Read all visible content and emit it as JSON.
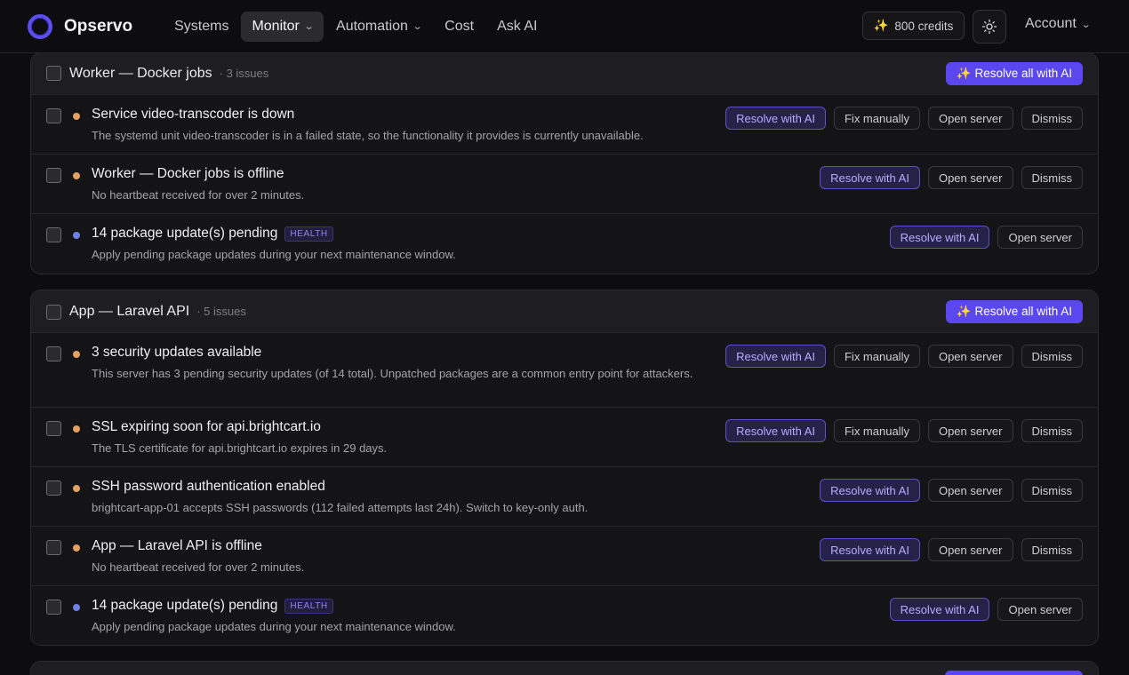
{
  "app": {
    "name": "Opservo"
  },
  "nav": {
    "items": [
      {
        "label": "Systems",
        "active": false,
        "dropdown": false
      },
      {
        "label": "Monitor",
        "active": true,
        "dropdown": true
      },
      {
        "label": "Automation",
        "active": false,
        "dropdown": true
      },
      {
        "label": "Cost",
        "active": false,
        "dropdown": false
      },
      {
        "label": "Ask AI",
        "active": false,
        "dropdown": false
      }
    ]
  },
  "header": {
    "credits_label": "800 credits",
    "credits_icon": "sparkles-icon",
    "theme_icon": "sun-icon",
    "account_label": "Account"
  },
  "colors": {
    "accent": "#5b47f0",
    "warning_dot": "#e3a063",
    "info_dot": "#6f7fe6"
  },
  "groups": [
    {
      "title": "Worker — Docker jobs",
      "count": "· 3 issues",
      "resolve_all_label": "✨ Resolve all with AI",
      "issues": [
        {
          "title": "Service video-transcoder is down",
          "description": "The systemd unit video-transcoder is in a failed state, so the functionality it provides is currently unavailable.",
          "severity": "warning",
          "badge": "",
          "actions": [
            "Resolve with AI",
            "Fix manually",
            "Open server",
            "Dismiss"
          ]
        },
        {
          "title": "Worker — Docker jobs is offline",
          "description": "No heartbeat received for over 2 minutes.",
          "severity": "warning",
          "badge": "",
          "actions": [
            "Resolve with AI",
            "Open server",
            "Dismiss"
          ]
        },
        {
          "title": "14 package update(s) pending",
          "description": "Apply pending package updates during your next maintenance window.",
          "severity": "info",
          "badge": "HEALTH",
          "actions": [
            "Resolve with AI",
            "Open server"
          ]
        }
      ]
    },
    {
      "title": "App — Laravel API",
      "count": "· 5 issues",
      "resolve_all_label": "✨ Resolve all with AI",
      "issues": [
        {
          "title": "3 security updates available",
          "description": "This server has 3 pending security updates (of 14 total). Unpatched packages are a common entry point for attackers.",
          "severity": "warning",
          "badge": "",
          "actions": [
            "Resolve with AI",
            "Fix manually",
            "Open server",
            "Dismiss"
          ]
        },
        {
          "title": "SSL expiring soon for api.brightcart.io",
          "description": "The TLS certificate for api.brightcart.io expires in 29 days.",
          "severity": "warning",
          "badge": "",
          "actions": [
            "Resolve with AI",
            "Fix manually",
            "Open server",
            "Dismiss"
          ]
        },
        {
          "title": "SSH password authentication enabled",
          "description": "brightcart-app-01 accepts SSH passwords (112 failed attempts last 24h). Switch to key-only auth.",
          "severity": "warning",
          "badge": "",
          "actions": [
            "Resolve with AI",
            "Open server",
            "Dismiss"
          ]
        },
        {
          "title": "App — Laravel API is offline",
          "description": "No heartbeat received for over 2 minutes.",
          "severity": "warning",
          "badge": "",
          "actions": [
            "Resolve with AI",
            "Open server",
            "Dismiss"
          ]
        },
        {
          "title": "14 package update(s) pending",
          "description": "Apply pending package updates during your next maintenance window.",
          "severity": "info",
          "badge": "HEALTH",
          "actions": [
            "Resolve with AI",
            "Open server"
          ]
        }
      ]
    }
  ]
}
